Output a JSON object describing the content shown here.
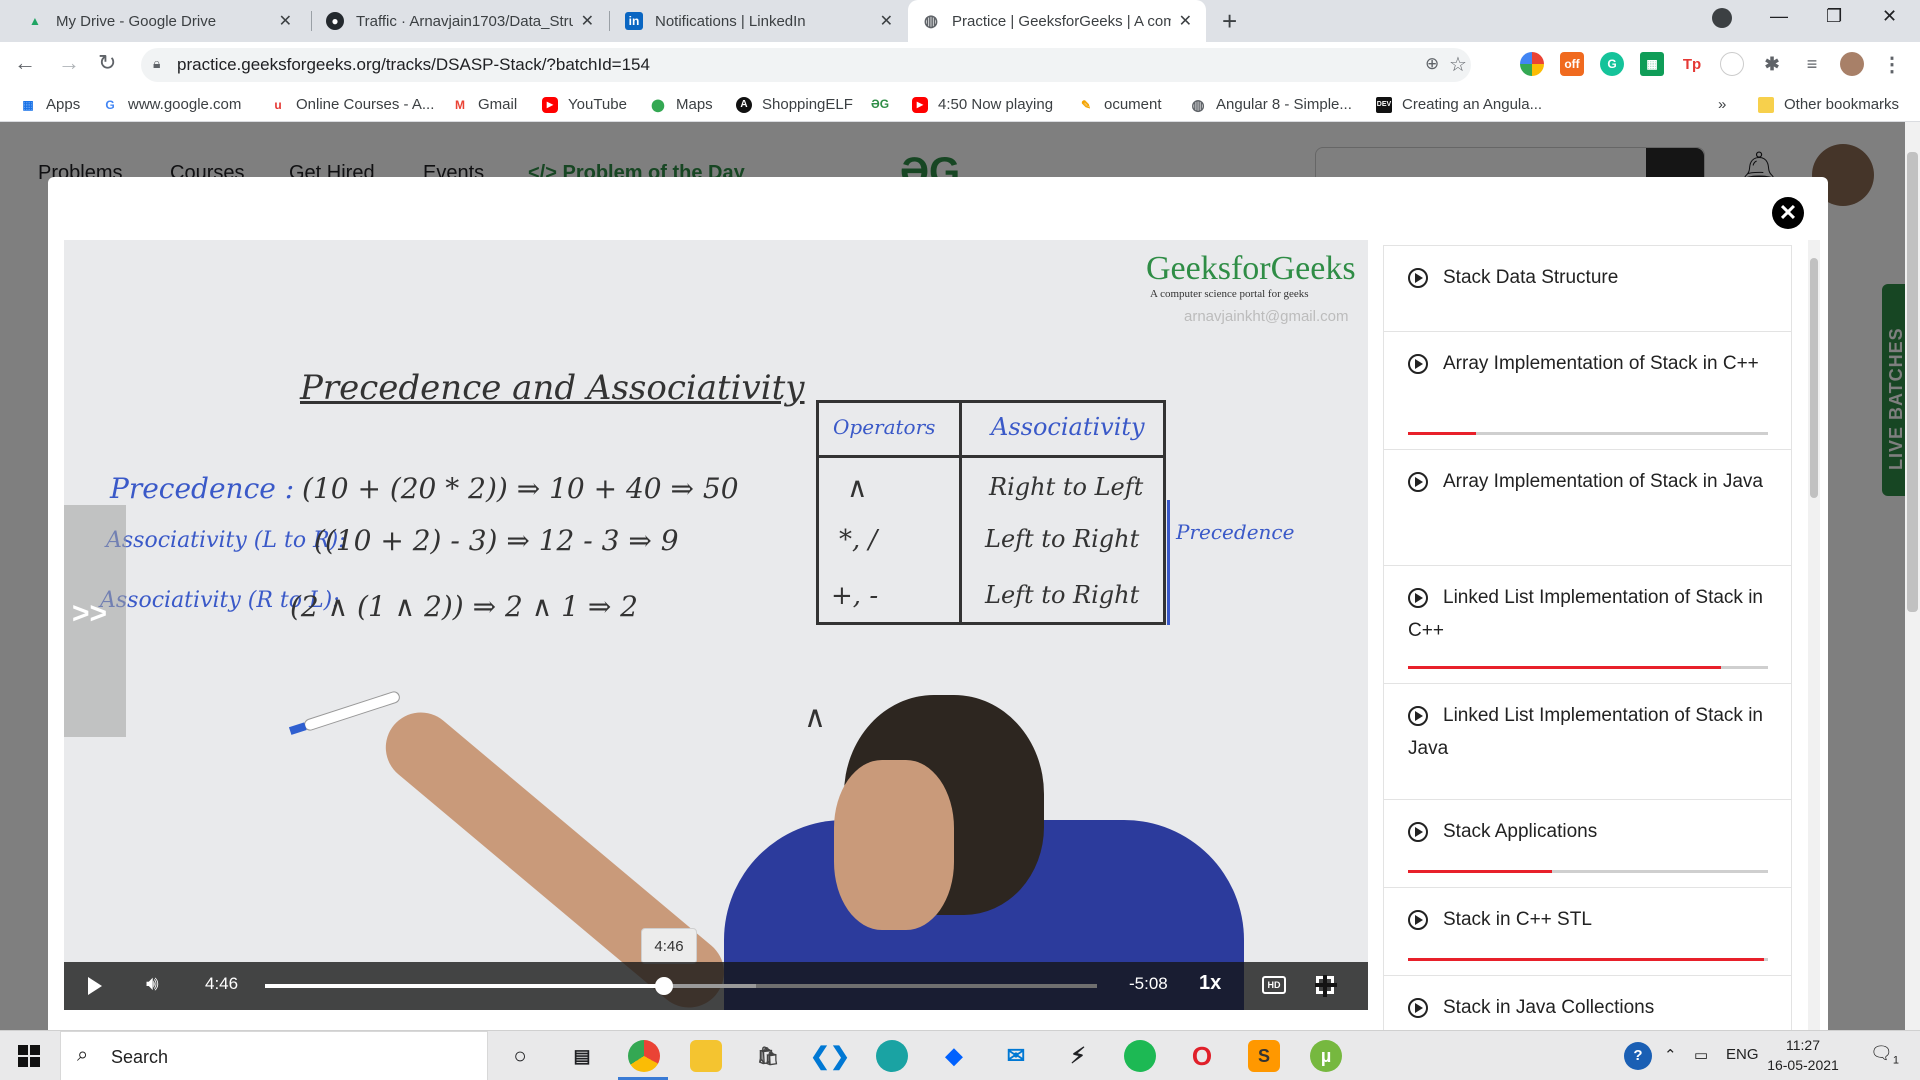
{
  "browser": {
    "tabs": [
      {
        "title": "My Drive - Google Drive",
        "icon": "google-drive-icon",
        "color": "#1fa463"
      },
      {
        "title": "Traffic · Arnavjain1703/Data_Struc",
        "icon": "github-icon",
        "color": "#24292e"
      },
      {
        "title": "Notifications | LinkedIn",
        "icon": "linkedin-icon",
        "color": "#0a66c2"
      },
      {
        "title": "Practice | GeeksforGeeks | A com",
        "icon": "globe-icon",
        "color": "#5f6368",
        "active": true
      }
    ],
    "url": "practice.geeksforgeeks.org/tracks/DSASP-Stack/?batchId=154",
    "bookmarks": [
      {
        "label": "Apps",
        "icon": "apps-grid-icon"
      },
      {
        "label": "www.google.com",
        "icon": "google-icon"
      },
      {
        "label": "Online Courses - A...",
        "icon": "udemy-icon"
      },
      {
        "label": "Gmail",
        "icon": "gmail-icon"
      },
      {
        "label": "YouTube",
        "icon": "youtube-icon"
      },
      {
        "label": "Maps",
        "icon": "maps-pin-icon"
      },
      {
        "label": "ShoppingELF",
        "icon": "shoppingelf-icon"
      },
      {
        "label": "",
        "icon": "gfg-icon"
      },
      {
        "label": "4:50 Now playing",
        "icon": "youtube-icon"
      },
      {
        "label": "ocument",
        "icon": "document-icon"
      },
      {
        "label": "Angular 8 - Simple...",
        "icon": "globe-icon"
      },
      {
        "label": "Creating an Angula...",
        "icon": "dev-icon"
      }
    ],
    "bookmarks_overflow": "»",
    "other_bookmarks": "Other bookmarks"
  },
  "site": {
    "nav": [
      "Problems",
      "Courses",
      "Get Hired",
      "Events",
      "</> Problem of the Day"
    ],
    "live_batches": "LIVE BATCHES"
  },
  "video": {
    "whiteboard": {
      "brand": "GeeksforGeeks",
      "tagline": "A computer science portal for geeks",
      "email": "arnavjainkht@gmail.com",
      "title": "Precedence and Associativity",
      "lines": [
        {
          "label": "Precedence :",
          "expr": "(10 + (20 * 2)) ⇒ 10 + 40 ⇒ 50"
        },
        {
          "label": "Associativity (L to R):",
          "expr": "((10 + 2) - 3) ⇒ 12 - 3 ⇒ 9"
        },
        {
          "label": "Associativity (R to L):",
          "expr": "(2 ∧ (1 ∧ 2)) ⇒ 2 ∧ 1 ⇒ 2"
        }
      ],
      "table": {
        "headers": [
          "Operators",
          "Associativity"
        ],
        "rows": [
          [
            "∧",
            "Right to Left"
          ],
          [
            "*, /",
            "Left to Right"
          ],
          [
            "+, -",
            "Left to Right"
          ]
        ]
      },
      "side_note": "Precedence",
      "stray_mark": "∧"
    },
    "side_handle": ">>",
    "tooltip_time": "4:46",
    "current_time": "4:46",
    "remaining_time": "-5:08",
    "speed": "1x",
    "hd_label": "HD",
    "progress": 0.48,
    "buffered": 0.59
  },
  "playlist": [
    {
      "title": "Stack Data Structure",
      "progress": null
    },
    {
      "title": "Array Implementation of Stack in C++",
      "progress": 0.19
    },
    {
      "title": "Array Implementation of Stack in Java",
      "progress": null
    },
    {
      "title": "Linked List Implementation of Stack in C++",
      "progress": 0.87
    },
    {
      "title": "Linked List Implementation of Stack in Java",
      "progress": null
    },
    {
      "title": "Stack Applications",
      "progress": 0.4
    },
    {
      "title": "Stack in C++ STL",
      "progress": 0.99
    },
    {
      "title": "Stack in Java Collections",
      "progress": null
    }
  ],
  "taskbar": {
    "search_label": "Search",
    "language": "ENG",
    "time": "11:27",
    "date": "16-05-2021",
    "notification_count": "1"
  },
  "colors": {
    "gfg_green": "#2f8d46",
    "progress_red": "#e8202a",
    "marker_blue": "#3a59c8"
  }
}
